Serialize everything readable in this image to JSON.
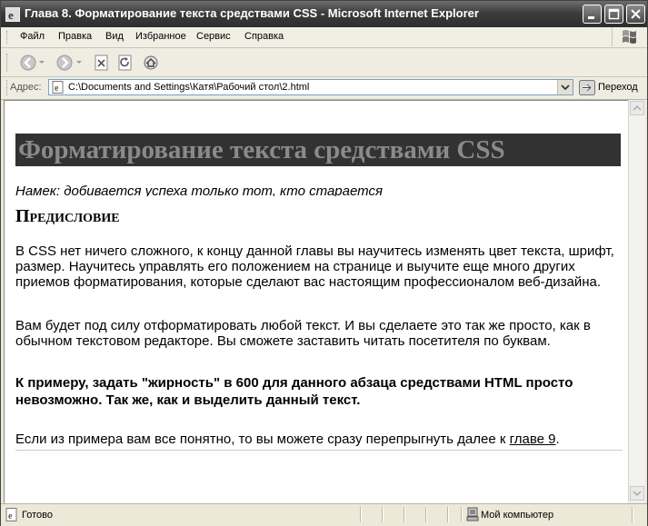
{
  "window": {
    "title": "Глава 8. Форматирование текста средствами CSS - Microsoft Internet Explorer"
  },
  "menu": {
    "items": [
      "Файл",
      "Правка",
      "Вид",
      "Избранное",
      "Сервис",
      "Справка"
    ]
  },
  "address": {
    "label": "Адрес:",
    "url": "C:\\Documents and Settings\\Катя\\Рабочий стол\\2.html",
    "go_label": "Переход"
  },
  "page": {
    "heading": "Форматирование текста средствами CSS",
    "motto": "Намек: добивается успеха только тот, кто старается",
    "subheading": "Предисловие",
    "p1": "В CSS нет ничего сложного, к концу данной главы вы научитесь изменять цвет текста, шрифт, размер. Научитесь управлять его положением на странице и выучите еще много других приемов форматирования, которые сделают вас настоящим профессионалом веб-дизайна.",
    "p2": "Вам будет под силу отформатировать любой текст. И вы сделаете это так же просто, как в обычном текстовом редакторе. Вы сможете заставить читать посетителя по буквам.",
    "p3": "К примеру, задать \"жирность\" в 600 для данного абзаца средствами HTML просто невозможно. Так же, как и выделить данный текст.",
    "p4_text": "Если из примера вам все понятно, то вы можете сразу перепрыгнуть далее к ",
    "p4_link": "главе 9",
    "p4_end": "."
  },
  "status": {
    "text": "Готово",
    "zone": "Мой компьютер"
  },
  "colors": {
    "heading_bg": "#323232",
    "heading_text": "#8a8a8a"
  }
}
